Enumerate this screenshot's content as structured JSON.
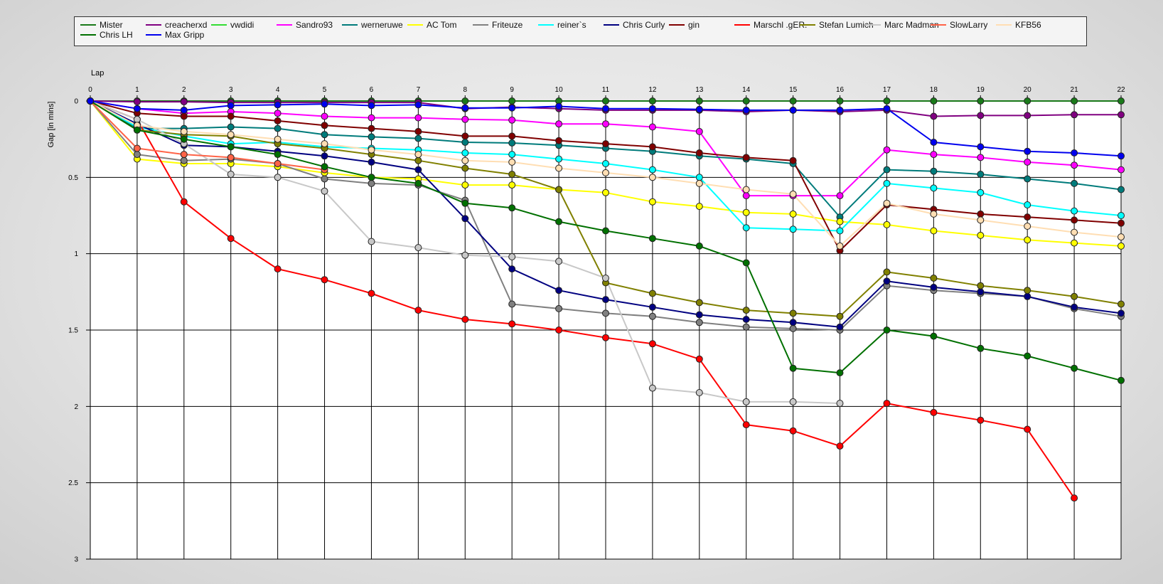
{
  "chart_data": {
    "type": "line",
    "title": "",
    "xlabel": "Lap",
    "ylabel": "Gap [in mins]",
    "x": [
      0,
      1,
      2,
      3,
      4,
      5,
      6,
      7,
      8,
      9,
      10,
      11,
      12,
      13,
      14,
      15,
      16,
      17,
      18,
      19,
      20,
      21,
      22
    ],
    "x_ticks": [
      "0",
      "1",
      "2",
      "3",
      "4",
      "5",
      "6",
      "7",
      "8",
      "9",
      "10",
      "11",
      "12",
      "13",
      "14",
      "15",
      "16",
      "17",
      "18",
      "19",
      "20",
      "21",
      "22"
    ],
    "y_ticks": [
      "0",
      "0.5",
      "1",
      "1.5",
      "2",
      "2.5",
      "3"
    ],
    "y_tick_values": [
      0,
      0.5,
      1,
      1.5,
      2,
      2.5,
      3
    ],
    "ylim": [
      0,
      3
    ],
    "y_inverted": true,
    "xaxis_position": "top",
    "grid": "horizontal lines at 0.5 intervals and vertical lines at each lap",
    "legend_position": "top",
    "series": [
      {
        "name": "Mister",
        "color": "#1a7a1a",
        "values": [
          0,
          0,
          0,
          0,
          0,
          0,
          0,
          0,
          0,
          0,
          0,
          0,
          0,
          0,
          0,
          0,
          0,
          0,
          0,
          0,
          0,
          0,
          0
        ]
      },
      {
        "name": "creacherxd",
        "color": "#800080",
        "values": [
          0,
          0.005,
          0.005,
          0.01,
          0.01,
          0.01,
          0.01,
          0.01,
          0.05,
          0.04,
          0.05,
          0.06,
          0.06,
          0.06,
          0.07,
          0.06,
          0.07,
          0.06,
          0.1,
          0.095,
          0.095,
          0.09,
          0.09
        ]
      },
      {
        "name": "vwdidi",
        "color": "#33dd33",
        "values": [
          0,
          null,
          null,
          null,
          null,
          null,
          null,
          null,
          null,
          null,
          null,
          null,
          null,
          null,
          null,
          null,
          null,
          null,
          null,
          null,
          null,
          null,
          null
        ]
      },
      {
        "name": "Sandro93",
        "color": "#ff00ff",
        "values": [
          0,
          0.05,
          0.08,
          0.07,
          0.08,
          0.1,
          0.11,
          0.11,
          0.12,
          0.125,
          0.15,
          0.15,
          0.17,
          0.2,
          0.62,
          0.62,
          0.62,
          0.32,
          0.35,
          0.37,
          0.4,
          0.42,
          0.45
        ]
      },
      {
        "name": "werneruwe",
        "color": "#007b7b",
        "values": [
          0,
          0.18,
          0.18,
          0.17,
          0.18,
          0.22,
          0.235,
          0.245,
          0.27,
          0.275,
          0.29,
          0.31,
          0.33,
          0.36,
          0.38,
          0.41,
          0.76,
          0.45,
          0.46,
          0.48,
          0.51,
          0.54,
          0.58
        ]
      },
      {
        "name": "AC Tom",
        "color": "#ffff00",
        "values": [
          0,
          0.38,
          0.41,
          0.41,
          0.43,
          0.47,
          0.5,
          0.51,
          0.55,
          0.55,
          0.58,
          0.6,
          0.66,
          0.69,
          0.73,
          0.74,
          0.79,
          0.81,
          0.85,
          0.88,
          0.91,
          0.93,
          0.95
        ]
      },
      {
        "name": "Friteuze",
        "color": "#808080",
        "values": [
          0,
          0.35,
          0.39,
          0.38,
          0.41,
          0.51,
          0.54,
          0.55,
          0.65,
          1.33,
          1.36,
          1.39,
          1.41,
          1.45,
          1.48,
          1.49,
          1.5,
          1.21,
          1.24,
          1.26,
          1.28,
          1.36,
          1.41
        ]
      },
      {
        "name": "reiner`s",
        "color": "#00ffff",
        "values": [
          0,
          0.17,
          0.23,
          0.28,
          0.27,
          0.3,
          0.31,
          0.32,
          0.34,
          0.35,
          0.38,
          0.41,
          0.45,
          0.5,
          0.83,
          0.84,
          0.85,
          0.54,
          0.57,
          0.6,
          0.68,
          0.72,
          0.75
        ]
      },
      {
        "name": "Chris Curly",
        "color": "#000080",
        "values": [
          0,
          0.15,
          0.29,
          0.3,
          0.33,
          0.36,
          0.4,
          0.45,
          0.77,
          1.1,
          1.24,
          1.3,
          1.35,
          1.4,
          1.43,
          1.45,
          1.48,
          1.18,
          1.22,
          1.25,
          1.28,
          1.35,
          1.39
        ]
      },
      {
        "name": "gin",
        "color": "#800000",
        "values": [
          0,
          0.08,
          0.1,
          0.1,
          0.13,
          0.16,
          0.18,
          0.2,
          0.23,
          0.23,
          0.26,
          0.28,
          0.3,
          0.34,
          0.37,
          0.39,
          0.98,
          0.68,
          0.71,
          0.74,
          0.76,
          0.78,
          0.8
        ]
      },
      {
        "name": "Marschl .gER.",
        "color": "#ff0000",
        "values": [
          0,
          0.12,
          0.66,
          0.9,
          1.1,
          1.17,
          1.26,
          1.37,
          1.43,
          1.46,
          1.5,
          1.55,
          1.59,
          1.69,
          2.12,
          2.16,
          2.26,
          1.98,
          2.04,
          2.09,
          2.15,
          2.6,
          null
        ]
      },
      {
        "name": "Stefan Lumich",
        "color": "#808000",
        "values": [
          0,
          0.19,
          0.22,
          0.23,
          0.28,
          0.31,
          0.35,
          0.39,
          0.44,
          0.48,
          0.58,
          1.19,
          1.26,
          1.32,
          1.37,
          1.39,
          1.41,
          1.12,
          1.16,
          1.21,
          1.24,
          1.28,
          1.33
        ]
      },
      {
        "name": "Marc Madman",
        "color": "#c8c8c8",
        "values": [
          0,
          0.12,
          0.28,
          0.48,
          0.5,
          0.59,
          0.92,
          0.96,
          1.01,
          1.02,
          1.05,
          1.16,
          1.88,
          1.91,
          1.97,
          1.97,
          1.98,
          null,
          null,
          null,
          null,
          null,
          null
        ]
      },
      {
        "name": "SlowLarry",
        "color": "#ff6347",
        "values": [
          0,
          0.31,
          0.35,
          0.37,
          0.41,
          0.45,
          null,
          null,
          null,
          null,
          null,
          null,
          null,
          null,
          null,
          null,
          null,
          null,
          null,
          null,
          null,
          null,
          null
        ]
      },
      {
        "name": "KFB56",
        "color": "#ffdeb3",
        "values": [
          0,
          0.16,
          0.2,
          0.22,
          0.25,
          0.28,
          0.32,
          0.35,
          0.39,
          0.4,
          0.44,
          0.47,
          0.5,
          0.54,
          0.58,
          0.61,
          0.95,
          0.67,
          0.74,
          0.78,
          0.82,
          0.86,
          0.89
        ]
      },
      {
        "name": "Chris LH",
        "color": "#007000",
        "values": [
          0,
          0.19,
          0.25,
          0.3,
          0.35,
          0.43,
          0.5,
          0.54,
          0.67,
          0.7,
          0.79,
          0.85,
          0.9,
          0.95,
          1.06,
          1.75,
          1.78,
          1.5,
          1.54,
          1.62,
          1.67,
          1.75,
          1.83
        ]
      },
      {
        "name": "Max Gripp",
        "color": "#0000ee",
        "values": [
          0,
          0.05,
          0.06,
          0.03,
          0.025,
          0.02,
          0.03,
          0.025,
          0.045,
          0.045,
          0.035,
          0.05,
          0.05,
          0.055,
          0.06,
          0.06,
          0.06,
          0.05,
          0.27,
          0.3,
          0.33,
          0.34,
          0.36
        ]
      }
    ]
  }
}
